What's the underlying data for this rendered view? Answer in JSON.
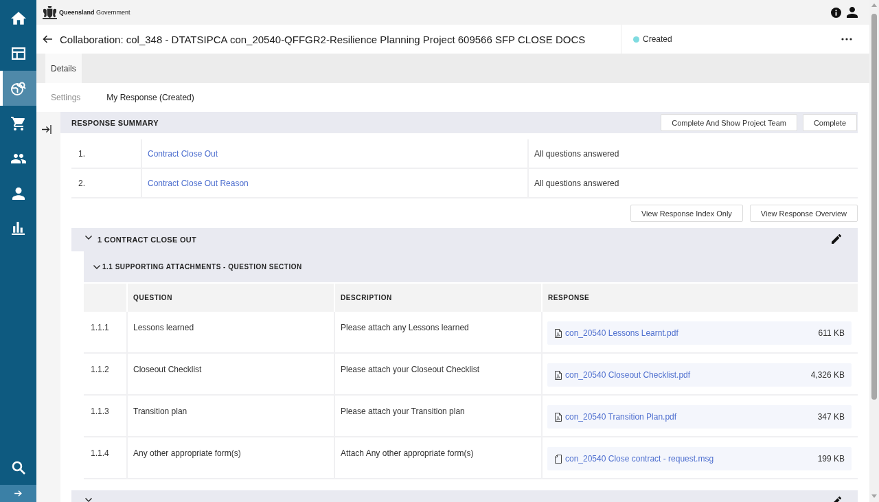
{
  "sidebar": {
    "items": [
      {
        "selected": false
      },
      {
        "selected": false
      },
      {
        "selected": true
      },
      {
        "selected": false
      },
      {
        "selected": false
      },
      {
        "selected": false
      },
      {
        "selected": false
      }
    ]
  },
  "header": {
    "logo_text": "**Queensland** Government"
  },
  "title_bar": {
    "title": "Collaboration: col_348 - DTATSIPCA con_20540-QFFGR2-Resilience Planning Project 609566 SFP CLOSE DOCS",
    "status": {
      "label": "Created",
      "color": "#7fdbe0"
    }
  },
  "tabs": [
    {
      "label": "Details",
      "selected": true
    }
  ],
  "subtabs": [
    {
      "label": "Settings",
      "selected": false
    },
    {
      "label": "My Response (Created)",
      "selected": true
    }
  ],
  "response_summary": {
    "title": "RESPONSE SUMMARY",
    "buttons": [
      "Complete And Show Project Team",
      "Complete"
    ],
    "rows": [
      {
        "number": "1.",
        "section": "Contract Close Out",
        "status": "All questions answered"
      },
      {
        "number": "2.",
        "section": "Contract Close Out Reason",
        "status": "All questions answered"
      }
    ],
    "view_buttons": [
      "View Response Index Only",
      "View Response Overview"
    ]
  },
  "sections": [
    {
      "title": "1 CONTRACT CLOSE OUT",
      "expanded": true,
      "subsections": [
        {
          "title": "1.1 SUPPORTING ATTACHMENTS - QUESTION SECTION",
          "expanded": true,
          "columns": [
            "QUESTION",
            "DESCRIPTION",
            "RESPONSE"
          ],
          "rows": [
            {
              "number": "1.1.1",
              "question": "Lessons learned",
              "description": "Please attach any Lessons learned",
              "response": {
                "kind": "pdf",
                "name": "con_20540 Lessons Learnt.pdf",
                "size": "611 KB"
              }
            },
            {
              "number": "1.1.2",
              "question": "Closeout Checklist",
              "description": "Please attach your Closeout Checklist",
              "response": {
                "kind": "pdf",
                "name": "con_20540 Closeout Checklist.pdf",
                "size": "4,326 KB"
              }
            },
            {
              "number": "1.1.3",
              "question": "Transition plan",
              "description": "Please attach your Transition plan",
              "response": {
                "kind": "pdf",
                "name": "con_20540 Transition Plan.pdf",
                "size": "347 KB"
              }
            },
            {
              "number": "1.1.4",
              "question": "Any other appropriate form(s)",
              "description": "Attach Any other appropriate form(s)",
              "response": {
                "kind": "msg",
                "name": "con_20540 Close contract - request.msg",
                "size": "199 KB"
              }
            }
          ]
        }
      ]
    },
    {
      "expanded": true
    }
  ]
}
